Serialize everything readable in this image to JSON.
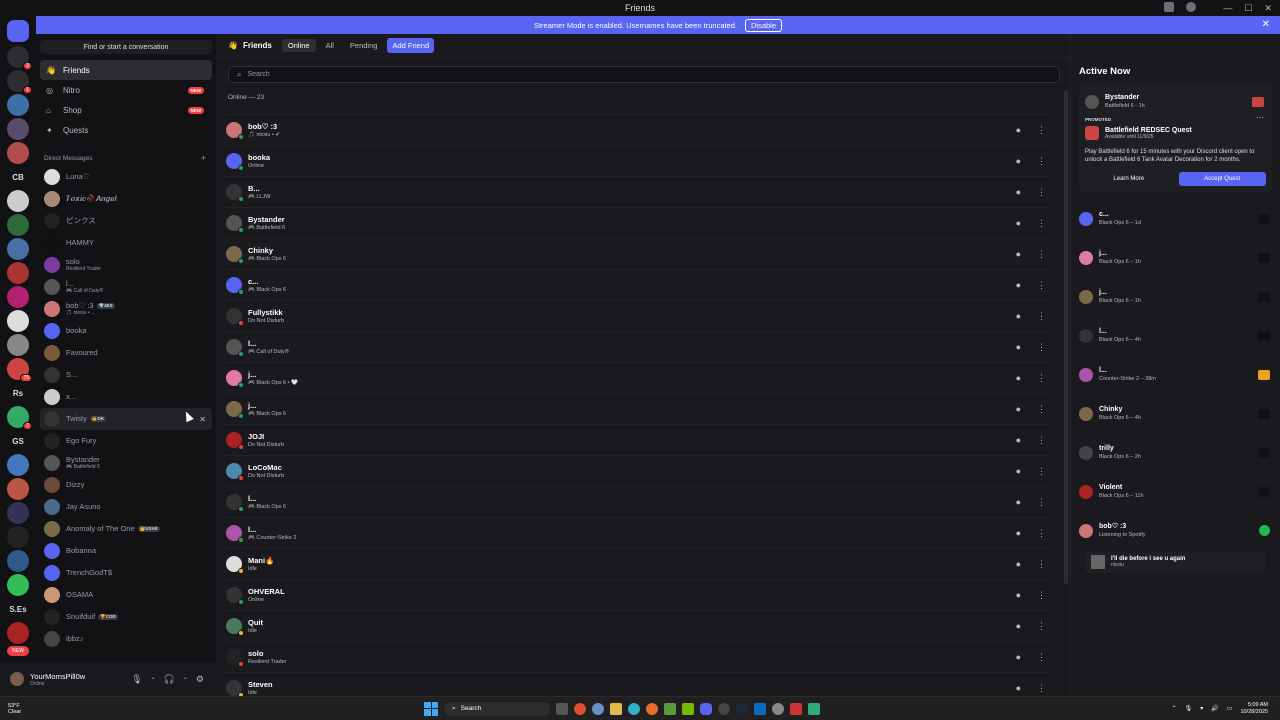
{
  "window": {
    "title": "Friends"
  },
  "banner": {
    "text": "Streamer Mode is enabled. Usernames have been truncated.",
    "disable_label": "Disable"
  },
  "guilds": [
    {
      "label": "",
      "color": "#5865f2",
      "badge": ""
    },
    {
      "label": "",
      "color": "#2b2d31",
      "badge": "2"
    },
    {
      "label": "",
      "color": "#2b2d31",
      "badge": "1"
    },
    {
      "label": "",
      "color": "#3d6fa8",
      "badge": ""
    },
    {
      "label": "",
      "color": "#5a4a6b",
      "badge": ""
    },
    {
      "label": "",
      "color": "#b34d4d",
      "badge": ""
    },
    {
      "label": "CB",
      "color": "",
      "badge": ""
    },
    {
      "label": "",
      "color": "#cccccc",
      "badge": ""
    },
    {
      "label": "",
      "color": "#2d6b3a",
      "badge": ""
    },
    {
      "label": "",
      "color": "#4a6fa5",
      "badge": ""
    },
    {
      "label": "",
      "color": "#a33",
      "badge": ""
    },
    {
      "label": "",
      "color": "#b3206f",
      "badge": ""
    },
    {
      "label": "",
      "color": "#ddd",
      "badge": ""
    },
    {
      "label": "",
      "color": "#888",
      "badge": ""
    },
    {
      "label": "",
      "color": "#c44",
      "badge": "75"
    },
    {
      "label": "Rs",
      "color": "",
      "badge": ""
    },
    {
      "label": "",
      "color": "#3a6",
      "badge": "7"
    },
    {
      "label": "GS",
      "color": "",
      "badge": ""
    },
    {
      "label": "",
      "color": "#4477bb",
      "badge": ""
    },
    {
      "label": "",
      "color": "#b54",
      "badge": ""
    },
    {
      "label": "",
      "color": "#335",
      "badge": ""
    },
    {
      "label": "",
      "color": "#222",
      "badge": ""
    },
    {
      "label": "",
      "color": "#2d5a8a",
      "badge": ""
    },
    {
      "label": "",
      "color": "#3b5",
      "badge": ""
    },
    {
      "label": "S.Es",
      "color": "",
      "badge": ""
    },
    {
      "label": "",
      "color": "#a22",
      "badge": ""
    },
    {
      "label": "NEW",
      "color": "",
      "badge": ""
    }
  ],
  "sidebar": {
    "find_placeholder": "Find or start a conversation",
    "nav": [
      {
        "label": "Friends",
        "icon": "friends-icon",
        "new": ""
      },
      {
        "label": "Nitro",
        "icon": "nitro-icon",
        "new": "NEW"
      },
      {
        "label": "Shop",
        "icon": "shop-icon",
        "new": "NEW"
      },
      {
        "label": "Quests",
        "icon": "quests-icon",
        "new": ""
      }
    ],
    "dm_header": "Direct Messages",
    "dms": [
      {
        "name": "Luna♡",
        "sub": "",
        "tag": "",
        "color": "#ddd"
      },
      {
        "name": "𝑻𝒐𝒙𝒊𝒄🥀𝑨𝒏𝒈𝒆𝒍",
        "sub": "",
        "tag": "",
        "color": "#a87"
      },
      {
        "name": "ピンクス",
        "sub": "",
        "tag": "",
        "color": "#222"
      },
      {
        "name": "HAMMY",
        "sub": "",
        "tag": "",
        "color": "#111"
      },
      {
        "name": "solo",
        "sub": "Resilient Trader",
        "tag": "",
        "color": "#7a3ca0"
      },
      {
        "name": "l...",
        "sub": "🎮 Call of Duty®",
        "tag": "",
        "color": "#555"
      },
      {
        "name": "bob♡ :3",
        "sub": "🎵 nixxiu • ...",
        "tag": "💎4ES",
        "color": "#c77"
      },
      {
        "name": "booka",
        "sub": "",
        "tag": "",
        "color": "#5865f2"
      },
      {
        "name": "Favoured",
        "sub": "",
        "tag": "",
        "color": "#7a5a3a"
      },
      {
        "name": "S...",
        "sub": "",
        "tag": "",
        "color": "#333"
      },
      {
        "name": "x...",
        "sub": "",
        "tag": "",
        "color": "#ccc"
      },
      {
        "name": "Twisty",
        "sub": "",
        "tag": "🤠DK",
        "color": "#333"
      },
      {
        "name": "Ego Fury",
        "sub": "",
        "tag": "",
        "color": "#222"
      },
      {
        "name": "Bystander",
        "sub": "🎮 Battlefield 6",
        "tag": "",
        "color": "#555"
      },
      {
        "name": "Dizzy",
        "sub": "",
        "tag": "",
        "color": "#6a4a3a"
      },
      {
        "name": "Jay Asuno",
        "sub": "",
        "tag": "",
        "color": "#4a6a8a"
      },
      {
        "name": "Anomaly of The One",
        "sub": "",
        "tag": "👑USAE",
        "color": "#7a6a4a"
      },
      {
        "name": "Bobanna",
        "sub": "",
        "tag": "",
        "color": "#5865f2"
      },
      {
        "name": "TrenchGodT$",
        "sub": "",
        "tag": "",
        "color": "#5865f2"
      },
      {
        "name": "OSAMA",
        "sub": "",
        "tag": "",
        "color": "#c97"
      },
      {
        "name": "Snuifduif",
        "sub": "",
        "tag": "🏆COD",
        "color": "#222"
      },
      {
        "name": "ibbz♪",
        "sub": "",
        "tag": "",
        "color": "#444"
      }
    ]
  },
  "user": {
    "name": "YourMomsPill0w",
    "status": "Online"
  },
  "topbar": {
    "title": "Friends",
    "tabs": [
      {
        "label": "Online",
        "selected": true
      },
      {
        "label": "All",
        "selected": false
      },
      {
        "label": "Pending",
        "selected": false
      }
    ],
    "add_friend": "Add Friend"
  },
  "search": {
    "placeholder": "Search"
  },
  "online_count": "Online — 23",
  "friends": [
    {
      "name": "bob♡ :3",
      "status": "🎵 nixxiu • ✔",
      "dot": "#23a55a",
      "color": "#c77"
    },
    {
      "name": "booka",
      "status": "Online",
      "dot": "#23a55a",
      "color": "#5865f2"
    },
    {
      "name": "B...",
      "status": "🎮 LLJW",
      "dot": "#23a55a",
      "color": "#333"
    },
    {
      "name": "Bystander",
      "status": "🎮 Battlefield 6",
      "dot": "#23a55a",
      "color": "#555"
    },
    {
      "name": "Chinky",
      "status": "🎮 Black Ops 6",
      "dot": "#23a55a",
      "color": "#7a6a4a"
    },
    {
      "name": "c...",
      "status": "🎮 Black Ops 6",
      "dot": "#23a55a",
      "color": "#5865f2"
    },
    {
      "name": "Fullystikk",
      "status": "Do Not Disturb",
      "dot": "#f23f43",
      "color": "#333"
    },
    {
      "name": "l...",
      "status": "🎮 Call of Duty®",
      "dot": "#23a55a",
      "color": "#555"
    },
    {
      "name": "j...",
      "status": "🎮 Black Ops 6 • 🤍",
      "dot": "#23a55a",
      "color": "#e07aa0"
    },
    {
      "name": "j...",
      "status": "🎮 Black Ops 6",
      "dot": "#23a55a",
      "color": "#7a6a4a"
    },
    {
      "name": "JOJI",
      "status": "Do Not Disturb",
      "dot": "#f23f43",
      "color": "#a22"
    },
    {
      "name": "LoCoMac",
      "status": "Do Not Disturb",
      "dot": "#f23f43",
      "color": "#4a8ab0"
    },
    {
      "name": "l...",
      "status": "🎮 Black Ops 6",
      "dot": "#23a55a",
      "color": "#333"
    },
    {
      "name": "l...",
      "status": "🎮 Counter-Strike 2",
      "dot": "#23a55a",
      "color": "#a5a"
    },
    {
      "name": "Mani🔥",
      "status": "Idle",
      "dot": "#f0b232",
      "color": "#ddd"
    },
    {
      "name": "OHVERAL",
      "status": "Online",
      "dot": "#23a55a",
      "color": "#333"
    },
    {
      "name": "Quit",
      "status": "Idle",
      "dot": "#f0b232",
      "color": "#4a7a5a"
    },
    {
      "name": "solo",
      "status": "Resilient Trader",
      "dot": "#f23f43",
      "color": "#222"
    },
    {
      "name": "Steven",
      "status": "Idle",
      "dot": "#f0b232",
      "color": "#333"
    }
  ],
  "active_now": {
    "title": "Active Now",
    "promo": {
      "user": "Bystander",
      "game": "Battlefield 6 - 1h",
      "label": "PROMOTED",
      "quest_title": "Battlefield REDSEC Quest",
      "quest_sub": "Available until 11/9/25",
      "desc": "Play Battlefield 6 for 15 minutes with your Discord client open to unlock a Battlefield 6 Tank Avatar Decoration for 2 months.",
      "learn": "Learn More",
      "accept": "Accept Quest"
    },
    "items": [
      {
        "name": "c...",
        "game": "Black Ops 6 – 1d",
        "color": "#5865f2",
        "icon": "#111"
      },
      {
        "name": "j...",
        "game": "Black Ops 6 – 1h",
        "color": "#e07aa0",
        "icon": "#111"
      },
      {
        "name": "j...",
        "game": "Black Ops 6 – 1h",
        "color": "#7a6a4a",
        "icon": "#111"
      },
      {
        "name": "l...",
        "game": "Black Ops 6 – 4h",
        "color": "#333",
        "icon": "#111"
      },
      {
        "name": "l...",
        "game": "Counter-Strike 2 – 38m",
        "color": "#a5a",
        "icon": "#e8a21e"
      },
      {
        "name": "Chinky",
        "game": "Black Ops 6 – 4h",
        "color": "#7a6a4a",
        "icon": "#111"
      },
      {
        "name": "trilly",
        "game": "Black Ops 6 – 2h",
        "color": "#444",
        "icon": "#111"
      },
      {
        "name": "Violent",
        "game": "Black Ops 6 – 11h",
        "color": "#a22",
        "icon": "#111"
      },
      {
        "name": "bob♡ :3",
        "game": "Listening to Spotify",
        "color": "#c77",
        "icon": "#1db954"
      }
    ],
    "spotify_track": "I'll die before i see u again",
    "spotify_artist": "nixxiu"
  },
  "taskbar": {
    "weather_temp": "53°F",
    "weather_desc": "Clear",
    "search": "Search",
    "time": "5:09 AM",
    "date": "10/28/2025"
  }
}
